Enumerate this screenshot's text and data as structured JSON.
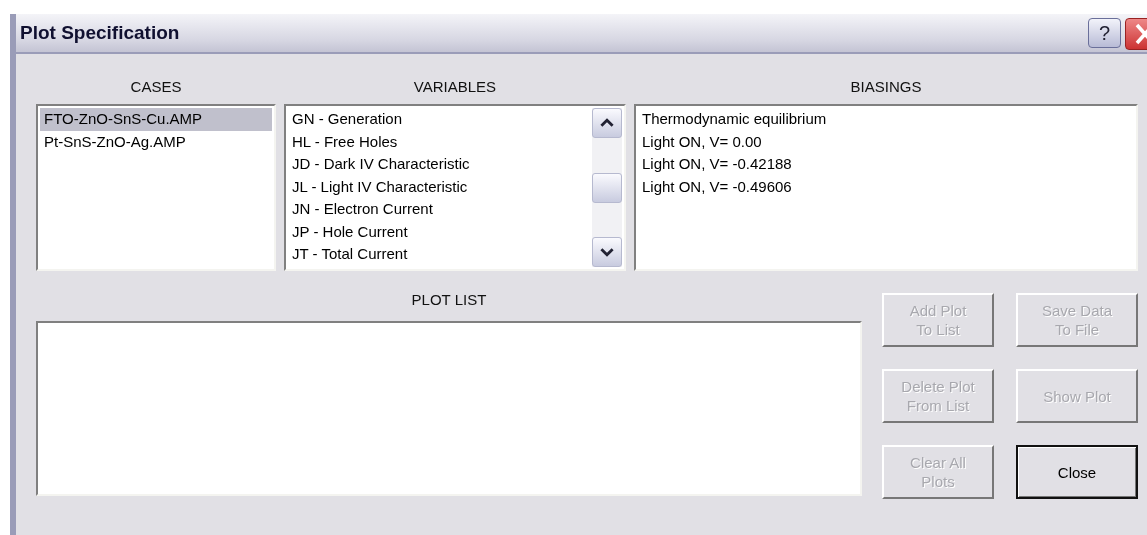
{
  "window": {
    "title": "Plot Specification",
    "help_button": "?"
  },
  "cases": {
    "label": "CASES",
    "items": [
      {
        "text": "FTO-ZnO-SnS-Cu.AMP",
        "selected": true
      },
      {
        "text": "Pt-SnS-ZnO-Ag.AMP",
        "selected": false
      }
    ]
  },
  "variables": {
    "label": "VARIABLES",
    "items": [
      {
        "text": "GN - Generation",
        "selected": false
      },
      {
        "text": "HL - Free Holes",
        "selected": false
      },
      {
        "text": "JD - Dark IV Characteristic",
        "selected": false
      },
      {
        "text": "JL - Light IV Characteristic",
        "selected": false
      },
      {
        "text": "JN - Electron Current",
        "selected": false
      },
      {
        "text": "JP - Hole Current",
        "selected": false
      },
      {
        "text": "JT - Total Current",
        "selected": false
      }
    ]
  },
  "biasings": {
    "label": "BIASINGS",
    "items": [
      {
        "text": "Thermodynamic equilibrium",
        "selected": false
      },
      {
        "text": "Light ON, V= 0.00",
        "selected": false
      },
      {
        "text": "Light ON, V= -0.42188",
        "selected": false
      },
      {
        "text": "Light ON, V= -0.49606",
        "selected": false
      }
    ]
  },
  "plot_list": {
    "label": "PLOT LIST"
  },
  "buttons": [
    {
      "label": "Add Plot\nTo List",
      "disabled": true,
      "default": false
    },
    {
      "label": "Save Data\nTo File",
      "disabled": true,
      "default": false
    },
    {
      "label": "Delete Plot\nFrom List",
      "disabled": true,
      "default": false
    },
    {
      "label": "Show Plot",
      "disabled": true,
      "default": false
    },
    {
      "label": "Clear All\nPlots",
      "disabled": true,
      "default": false
    },
    {
      "label": "Close",
      "disabled": false,
      "default": true
    }
  ]
}
